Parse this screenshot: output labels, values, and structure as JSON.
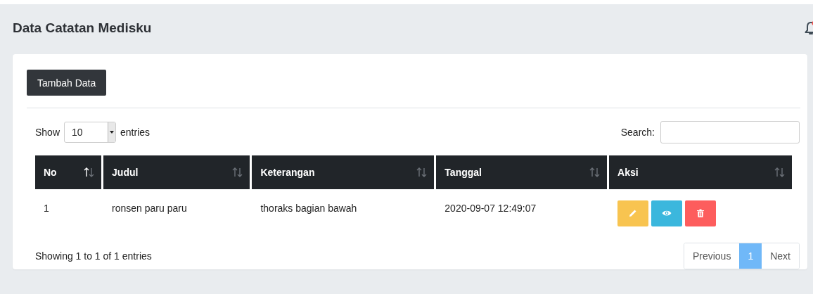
{
  "page_title": "Data Catatan Medisku",
  "notification": {
    "unread": true
  },
  "add_button": "Tambah Data",
  "length_control": {
    "label_before": "Show",
    "value": "10",
    "label_after": "entries"
  },
  "search": {
    "label": "Search:"
  },
  "table": {
    "columns": [
      {
        "label": "No",
        "sorted_ascending": true
      },
      {
        "label": "Judul",
        "sorted_ascending": false
      },
      {
        "label": "Keterangan",
        "sorted_ascending": false
      },
      {
        "label": "Tanggal",
        "sorted_ascending": false
      },
      {
        "label": "Aksi",
        "sorted_ascending": false
      }
    ],
    "rows": [
      {
        "cells": [
          "1",
          "ronsen paru paru",
          "thoraks bagian bawah",
          "2020-09-07 12:49:07"
        ],
        "actions": [
          {
            "kind": "edit"
          },
          {
            "kind": "view"
          },
          {
            "kind": "delete"
          }
        ]
      }
    ]
  },
  "info": "Showing 1 to 1 of 1 entries",
  "pagination": [
    {
      "label": "Previous",
      "selected": false
    },
    {
      "label": "1",
      "selected": true
    },
    {
      "label": "Next",
      "selected": false
    }
  ]
}
